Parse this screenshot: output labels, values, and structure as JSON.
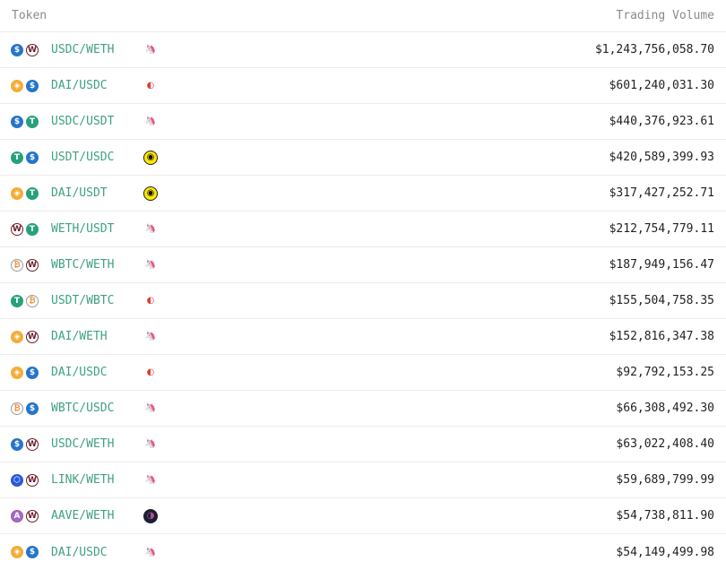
{
  "header": {
    "token": "Token",
    "volume": "Trading Volume"
  },
  "icon_styles": {
    "USDC": {
      "bg": "#2775ca",
      "fg": "#ffffff",
      "border": "#2775ca",
      "glyph": "$"
    },
    "WETH": {
      "bg": "#ffffff",
      "fg": "#6b1d2a",
      "border": "#6b1d2a",
      "glyph": "W"
    },
    "DAI": {
      "bg": "#f5ac37",
      "fg": "#ffffff",
      "border": "#f5ac37",
      "glyph": "◈"
    },
    "USDT": {
      "bg": "#26a17b",
      "fg": "#ffffff",
      "border": "#26a17b",
      "glyph": "T"
    },
    "WBTC": {
      "bg": "#ffffff",
      "fg": "#f09242",
      "border": "#9b9b9b",
      "glyph": "₿"
    },
    "LINK": {
      "bg": "#2a5ada",
      "fg": "#ffffff",
      "border": "#2a5ada",
      "glyph": "⬡"
    },
    "AAVE": {
      "bg": "#9d6cc9",
      "fg": "#ffffff",
      "border": "#b6509e",
      "glyph": "A"
    }
  },
  "dex_styles": {
    "uniswap": {
      "bg": "#ffffff",
      "fg": "#111111",
      "border": "#ffffff",
      "glyph": "🦄"
    },
    "curve": {
      "bg": "#ffffff",
      "fg": "#e53935",
      "border": "#ffffff",
      "glyph": "◐"
    },
    "dodo": {
      "bg": "#ffe804",
      "fg": "#111111",
      "border": "#222222",
      "glyph": "◉"
    },
    "aave-dex": {
      "bg": "#1b2030",
      "fg": "#b6509e",
      "border": "#1b2030",
      "glyph": "◑"
    }
  },
  "rows": [
    {
      "t1": "USDC",
      "t2": "WETH",
      "pair": "USDC/WETH",
      "dex": "uniswap",
      "volume": "$1,243,756,058.70"
    },
    {
      "t1": "DAI",
      "t2": "USDC",
      "pair": "DAI/USDC",
      "dex": "curve",
      "volume": "$601,240,031.30"
    },
    {
      "t1": "USDC",
      "t2": "USDT",
      "pair": "USDC/USDT",
      "dex": "uniswap",
      "volume": "$440,376,923.61"
    },
    {
      "t1": "USDT",
      "t2": "USDC",
      "pair": "USDT/USDC",
      "dex": "dodo",
      "volume": "$420,589,399.93"
    },
    {
      "t1": "DAI",
      "t2": "USDT",
      "pair": "DAI/USDT",
      "dex": "dodo",
      "volume": "$317,427,252.71"
    },
    {
      "t1": "WETH",
      "t2": "USDT",
      "pair": "WETH/USDT",
      "dex": "uniswap",
      "volume": "$212,754,779.11"
    },
    {
      "t1": "WBTC",
      "t2": "WETH",
      "pair": "WBTC/WETH",
      "dex": "uniswap",
      "volume": "$187,949,156.47"
    },
    {
      "t1": "USDT",
      "t2": "WBTC",
      "pair": "USDT/WBTC",
      "dex": "curve",
      "volume": "$155,504,758.35"
    },
    {
      "t1": "DAI",
      "t2": "WETH",
      "pair": "DAI/WETH",
      "dex": "uniswap",
      "volume": "$152,816,347.38"
    },
    {
      "t1": "DAI",
      "t2": "USDC",
      "pair": "DAI/USDC",
      "dex": "curve",
      "volume": "$92,792,153.25"
    },
    {
      "t1": "WBTC",
      "t2": "USDC",
      "pair": "WBTC/USDC",
      "dex": "uniswap",
      "volume": "$66,308,492.30"
    },
    {
      "t1": "USDC",
      "t2": "WETH",
      "pair": "USDC/WETH",
      "dex": "uniswap",
      "volume": "$63,022,408.40"
    },
    {
      "t1": "LINK",
      "t2": "WETH",
      "pair": "LINK/WETH",
      "dex": "uniswap",
      "volume": "$59,689,799.99"
    },
    {
      "t1": "AAVE",
      "t2": "WETH",
      "pair": "AAVE/WETH",
      "dex": "aave-dex",
      "volume": "$54,738,811.90"
    },
    {
      "t1": "DAI",
      "t2": "USDC",
      "pair": "DAI/USDC",
      "dex": "uniswap",
      "volume": "$54,149,499.98"
    }
  ]
}
